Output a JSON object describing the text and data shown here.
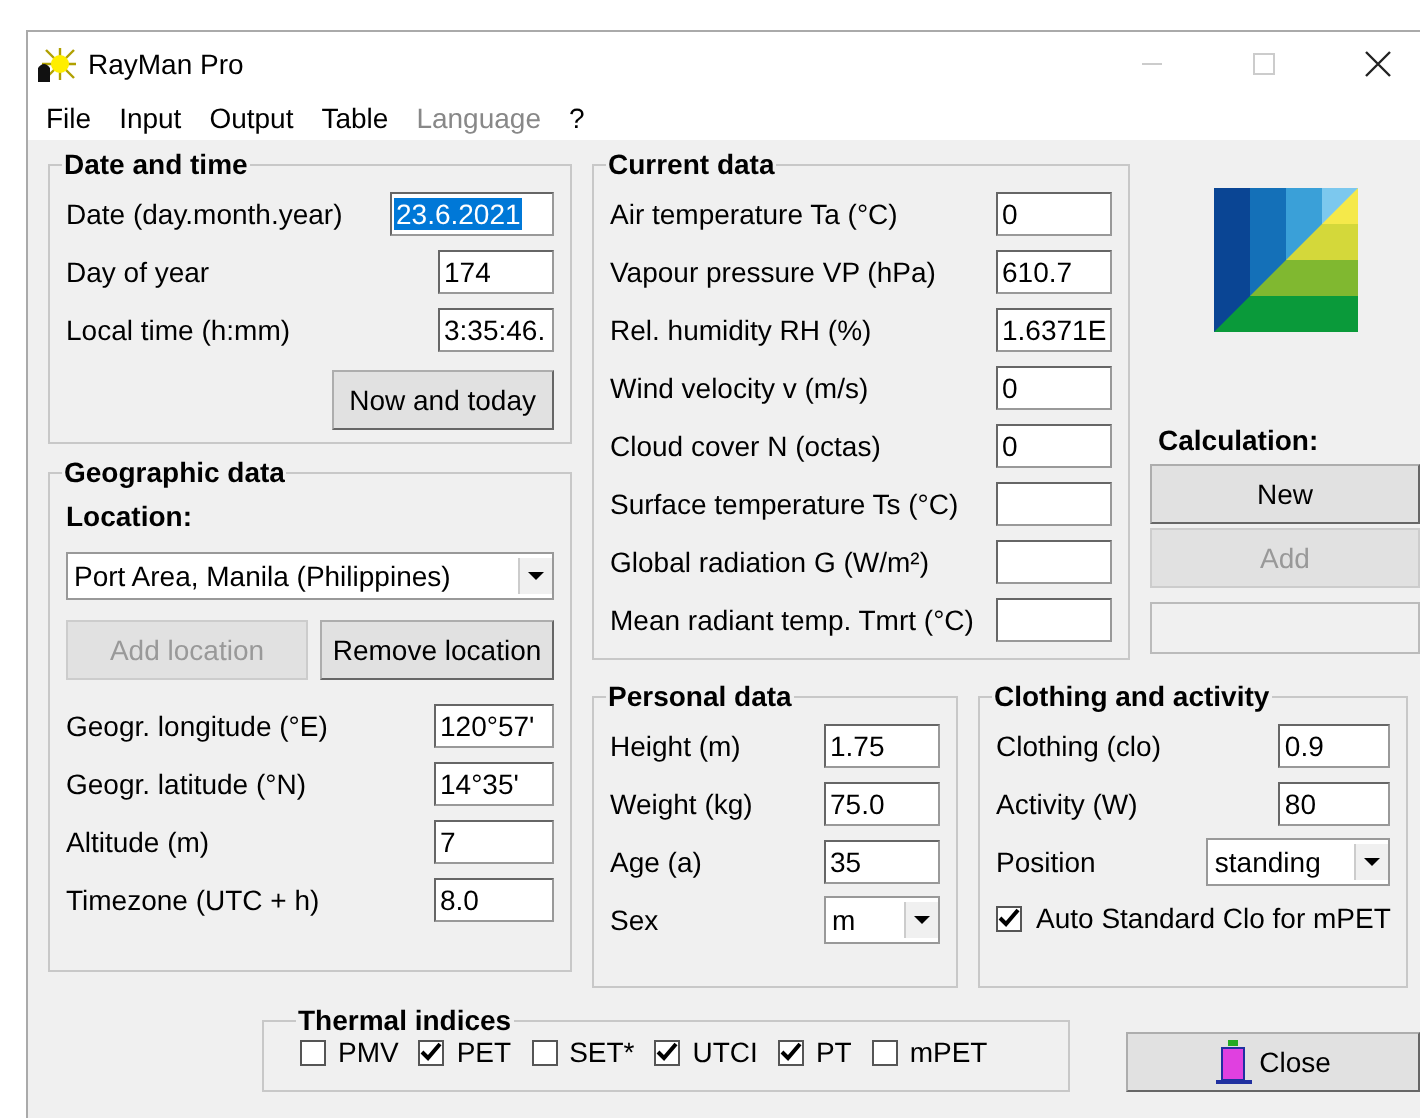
{
  "window": {
    "title": "RayMan Pro"
  },
  "menu": [
    {
      "label": "File",
      "disabled": false
    },
    {
      "label": "Input",
      "disabled": false
    },
    {
      "label": "Output",
      "disabled": false
    },
    {
      "label": "Table",
      "disabled": false
    },
    {
      "label": "Language",
      "disabled": true
    },
    {
      "label": "?",
      "disabled": false
    }
  ],
  "date_time": {
    "title": "Date and time",
    "fields": [
      {
        "label": "Date (day.month.year)",
        "value": "23.6.2021",
        "selected": true
      },
      {
        "label": "Day of year",
        "value": "174",
        "selected": false
      },
      {
        "label": "Local time (h:mm)",
        "value": "3:35:46.",
        "selected": false
      }
    ],
    "button": "Now and today"
  },
  "geographic": {
    "title": "Geographic data",
    "location_label": "Location:",
    "location": "Port Area, Manila (Philippines)",
    "buttons": [
      {
        "label": "Add location",
        "disabled": true
      },
      {
        "label": "Remove location",
        "disabled": false
      }
    ],
    "fields": [
      {
        "label": "Geogr. longitude (°E)",
        "value": "120°57'"
      },
      {
        "label": "Geogr. latitude (°N)",
        "value": "14°35'"
      },
      {
        "label": "Altitude (m)",
        "value": "7"
      },
      {
        "label": "Timezone (UTC + h)",
        "value": "8.0"
      }
    ]
  },
  "current_data": {
    "title": "Current data",
    "fields": [
      {
        "label": "Air temperature Ta (°C)",
        "value": "0"
      },
      {
        "label": "Vapour pressure VP (hPa)",
        "value": "610.7"
      },
      {
        "label": "Rel. humidity RH (%)",
        "value": "1.6371E"
      },
      {
        "label": "Wind velocity v (m/s)",
        "value": "0"
      },
      {
        "label": "Cloud cover N (octas)",
        "value": "0"
      },
      {
        "label": "Surface temperature Ts (°C)"
      },
      {
        "label": "Global radiation G (W/m²)"
      },
      {
        "label": "Mean radiant temp. Tmrt (°C)"
      }
    ]
  },
  "calculation": {
    "title": "Calculation:",
    "buttons": [
      {
        "label": "New",
        "disabled": false
      },
      {
        "label": "Add",
        "disabled": true
      }
    ]
  },
  "personal": {
    "title": "Personal data",
    "fields": [
      {
        "label": "Height (m)",
        "value": "1.75",
        "kind": "text"
      },
      {
        "label": "Weight (kg)",
        "value": "75.0",
        "kind": "text"
      },
      {
        "label": "Age (a)",
        "value": "35",
        "kind": "text"
      },
      {
        "label": "Sex",
        "value": "m",
        "kind": "dropdown"
      }
    ]
  },
  "clothing": {
    "title": "Clothing and activity",
    "fields": [
      {
        "label": "Clothing (clo)",
        "value": "0.9",
        "kind": "text"
      },
      {
        "label": "Activity (W)",
        "value": "80",
        "kind": "text"
      },
      {
        "label": "Position",
        "value": "standing",
        "kind": "dropdown"
      }
    ],
    "auto_clo": {
      "label": "Auto Standard Clo for mPET",
      "checked": true
    }
  },
  "thermal_indices": {
    "title": "Thermal indices",
    "items": [
      {
        "label": "PMV",
        "checked": false
      },
      {
        "label": "PET",
        "checked": true
      },
      {
        "label": "SET*",
        "checked": false
      },
      {
        "label": "UTCI",
        "checked": true
      },
      {
        "label": "PT",
        "checked": true
      },
      {
        "label": "mPET",
        "checked": false
      }
    ]
  },
  "close_button": "Close"
}
